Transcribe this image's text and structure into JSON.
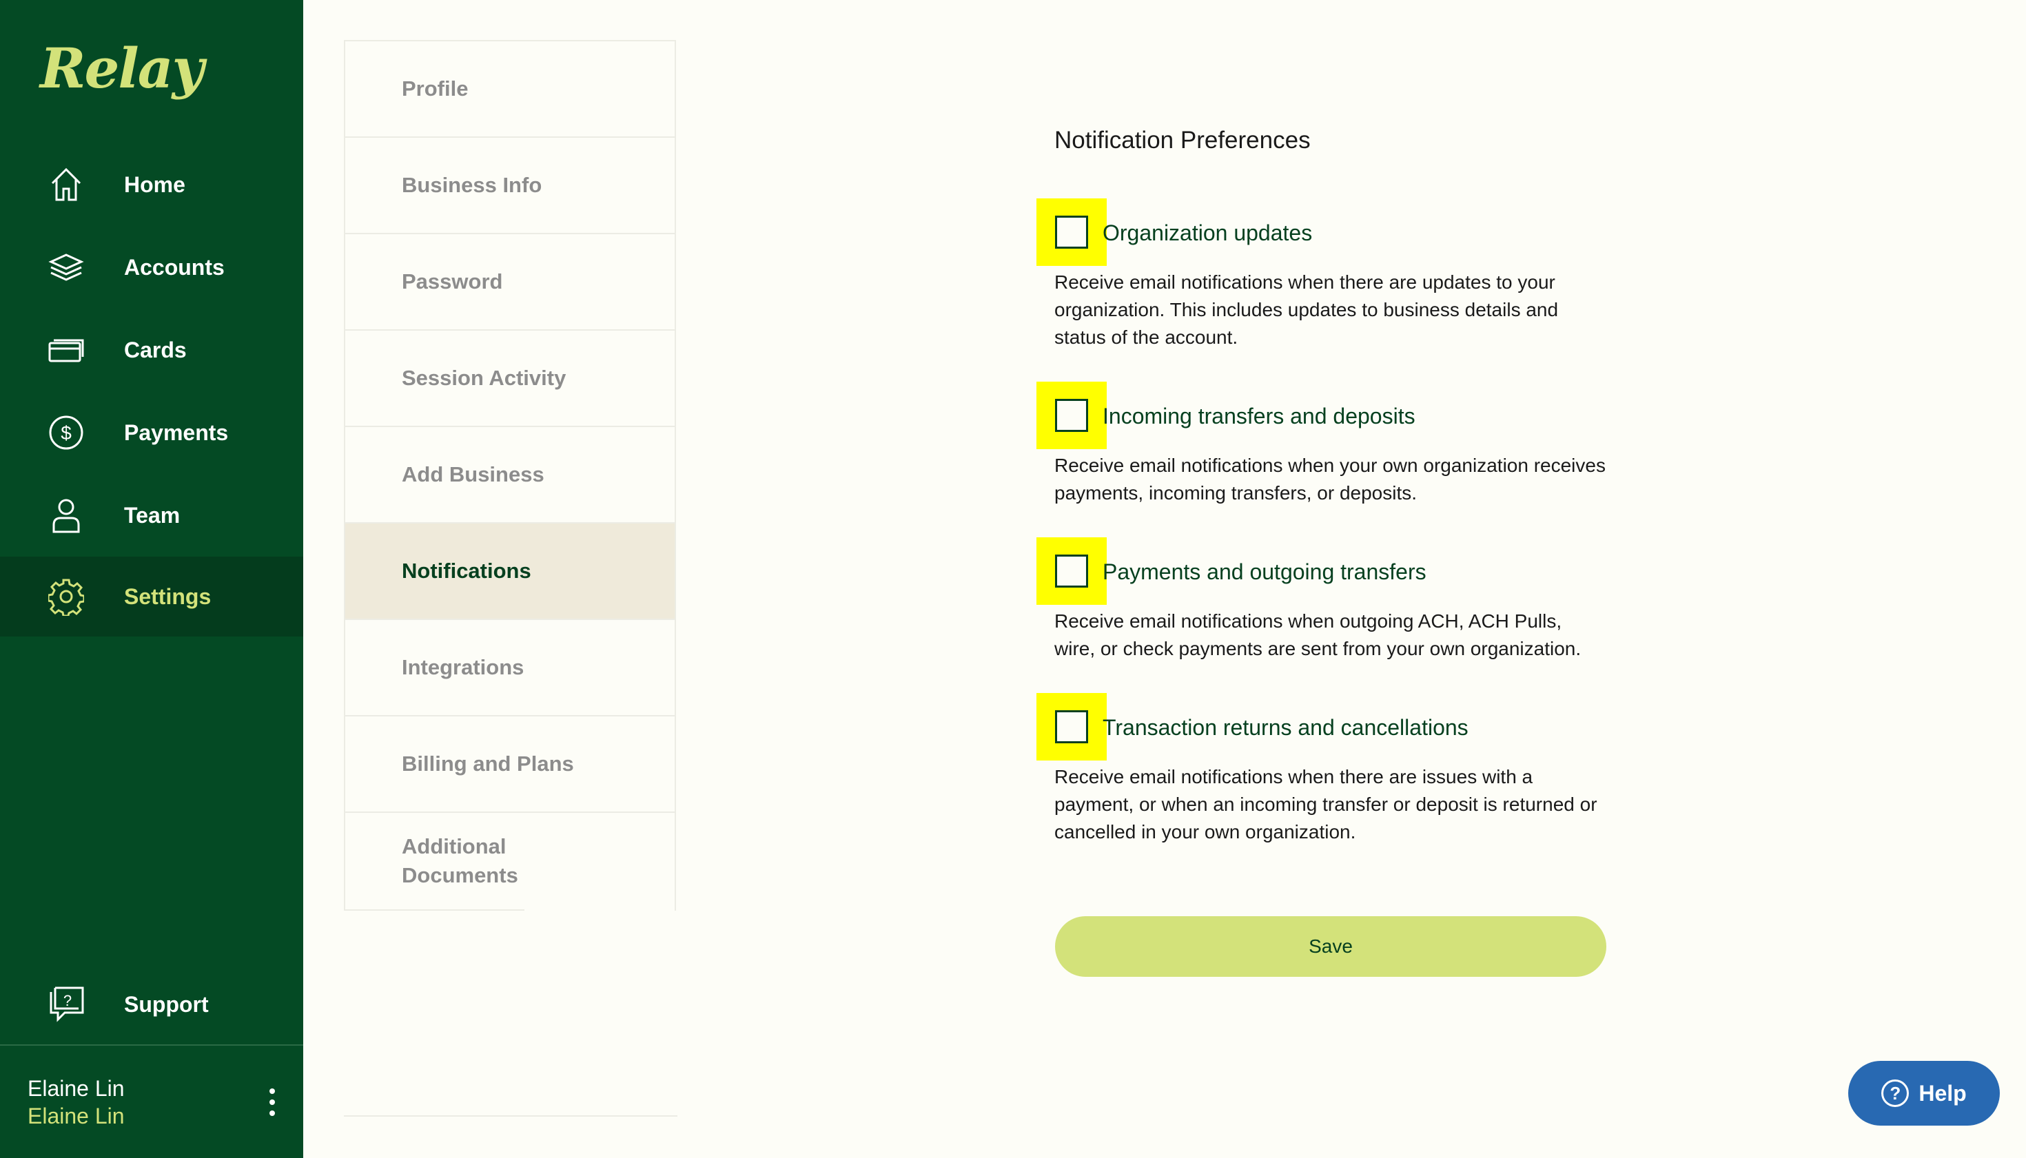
{
  "brand": {
    "logo_text": "Relay",
    "accent": "#D3E27A",
    "sidebar_bg": "#044A24"
  },
  "sidebar": {
    "items": [
      {
        "label": "Home",
        "icon": "home-icon"
      },
      {
        "label": "Accounts",
        "icon": "layers-icon"
      },
      {
        "label": "Cards",
        "icon": "card-icon"
      },
      {
        "label": "Payments",
        "icon": "dollar-circle-icon"
      },
      {
        "label": "Team",
        "icon": "person-icon"
      },
      {
        "label": "Settings",
        "icon": "gear-icon",
        "active": true
      }
    ],
    "support": {
      "label": "Support",
      "icon": "help-chat-icon"
    },
    "user": {
      "name": "Elaine Lin",
      "business": "Elaine Lin"
    }
  },
  "settings_nav": {
    "items": [
      {
        "label": "Profile"
      },
      {
        "label": "Business Info"
      },
      {
        "label": "Password"
      },
      {
        "label": "Session Activity"
      },
      {
        "label": "Add Business"
      },
      {
        "label": "Notifications",
        "active": true
      },
      {
        "label": "Integrations"
      },
      {
        "label": "Billing and Plans"
      },
      {
        "label": "Additional Documents"
      }
    ]
  },
  "main": {
    "title": "Notification Preferences",
    "preferences": [
      {
        "label": "Organization updates",
        "description": "Receive email notifications when there are updates to your organization. This includes updates to business details and status of the account.",
        "checked": false
      },
      {
        "label": "Incoming transfers and deposits",
        "description": "Receive email notifications when your own organization receives payments, incoming transfers, or deposits.",
        "checked": false
      },
      {
        "label": "Payments and outgoing transfers",
        "description": "Receive email notifications when outgoing ACH, ACH Pulls, wire, or check payments are sent from your own organization.",
        "checked": false
      },
      {
        "label": "Transaction returns and cancellations",
        "description": "Receive email notifications when there are issues with a payment, or when an incoming transfer or deposit is returned or cancelled in your own organization.",
        "checked": false
      }
    ],
    "save_label": "Save"
  },
  "help": {
    "label": "Help",
    "icon": "question-circle-icon"
  }
}
